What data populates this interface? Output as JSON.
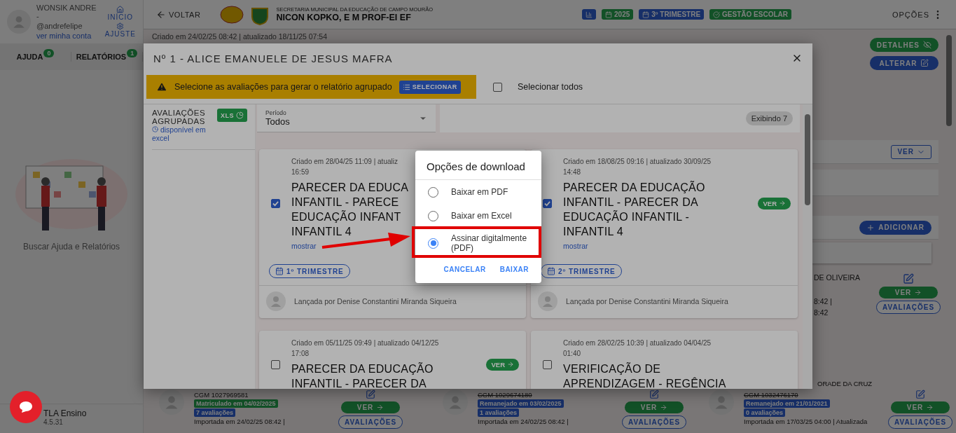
{
  "sidebar": {
    "user_name": "WONSIK ANDRE -",
    "username": "@andrefelipe",
    "account_link": "ver minha conta",
    "nav": [
      {
        "label": "INÍCIO",
        "kind": "home"
      },
      {
        "label": "AJUSTE",
        "kind": "settings"
      }
    ],
    "tabs": [
      {
        "label": "AJUDA",
        "count": "0"
      },
      {
        "label": "RELATÓRIOS",
        "count": "1"
      }
    ],
    "help_caption": "Buscar Ajuda e Relatórios",
    "app_name": "TLA Ensino",
    "version": "4.5.31"
  },
  "header": {
    "back": "VOLTAR",
    "department": "SECRETARIA MUNICIPAL DA EDUCAÇÃO DE CAMPO MOURÃO",
    "school": "NICON KOPKO, E M PROF-EI EF",
    "chips": [
      {
        "kind": "chart"
      },
      {
        "kind": "year",
        "label": "2025"
      },
      {
        "kind": "term",
        "label": "3º TRIMESTRE"
      },
      {
        "kind": "module",
        "label": "GESTÃO ESCOLAR"
      }
    ],
    "options": "OPÇÕES"
  },
  "record_info": "Criado em 24/02/25 08:42 | atualizado 18/11/25 07:54",
  "record_actions": [
    {
      "label": "DETALHES",
      "kind": "details"
    },
    {
      "label": "ALTERAR",
      "kind": "edit"
    }
  ],
  "sections": [
    {
      "kind": "toggle",
      "label": "VER"
    },
    {
      "kind": "empty"
    },
    {
      "kind": "add",
      "label": "ADICIONAR"
    }
  ],
  "previous_row": {
    "name": "DE OLIVEIRA",
    "lines": [
      "8:42 |",
      "8:42"
    ],
    "view": "VER",
    "evaluations": "AVALIAÇÕES"
  },
  "next_row_name": "ORADE DA CRUZ",
  "students": [
    {
      "cgm": "CGM 1027969581",
      "struck": false,
      "status": "Matriculado em 04/02/2025",
      "kind": "enrolled",
      "count": "7 avaliações",
      "imported": "Importada em 24/02/25 08:42 |",
      "view": "VER",
      "evaluations": "AVALIAÇÕES"
    },
    {
      "cgm": "CGM 1029674180",
      "struck": true,
      "status": "Remanejado em 03/02/2025",
      "kind": "moved",
      "count": "1 avaliações",
      "imported": "Importada em 24/02/25 08:42 |",
      "view": "VER",
      "evaluations": "AVALIAÇÕES"
    },
    {
      "cgm": "CGM 1032476170",
      "struck": true,
      "status": "Remanejado em 21/01/2021",
      "kind": "moved",
      "count": "0 avaliações",
      "imported": "Importada em 17/03/25 04:00 | Atualizada",
      "view": "VER",
      "evaluations": "AVALIAÇÕES"
    }
  ],
  "modal": {
    "title": "Nº 1 - ALICE EMANUELE DE JESUS MAFRA",
    "alert": {
      "text": "Selecione as avaliações para gerar o relatório agrupado",
      "button": "SELECIONAR"
    },
    "select_all": {
      "label": "Selecionar todos",
      "checked": false
    },
    "groups": {
      "title": "AVALIAÇÕES AGRUPADAS",
      "link": "disponível em excel",
      "button": "XLS"
    },
    "filter": {
      "label": "Período",
      "value": "Todos"
    },
    "count": "Exibindo 7",
    "evaluations": [
      {
        "checked": true,
        "date_lines": [
          "Criado em 28/04/25 11:09 | atualiz",
          "16:59"
        ],
        "title_lines": [
          "PARECER DA EDUCA",
          "INFANTIL - PARECE",
          "EDUCAÇÃO INFANT",
          "INFANTIL 4"
        ],
        "more": "mostrar",
        "term": "1º TRIMESTRE",
        "author": "Lançada por Denise Constantini Miranda Siqueira"
      },
      {
        "checked": true,
        "date_lines": [
          "Criado em 18/08/25 09:16 | atualizado 30/09/25",
          "14:48"
        ],
        "title_lines": [
          "PARECER DA EDUCAÇÃO",
          "INFANTIL - PARECER DA",
          "EDUCAÇÃO INFANTIL -",
          "INFANTIL 4"
        ],
        "more": "mostrar",
        "action": "VER",
        "term": "2º TRIMESTRE",
        "author": "Lançada por Denise Constantini Miranda Siqueira"
      },
      {
        "checked": false,
        "date_lines": [
          "Criado em 05/11/25 09:49 | atualizado 04/12/25",
          "17:08"
        ],
        "title_lines": [
          "PARECER DA EDUCAÇÃO",
          "INFANTIL - PARECER DA"
        ],
        "action": "VER"
      },
      {
        "checked": false,
        "date_lines": [
          "Criado em 28/02/25 10:39 | atualizado 04/04/25",
          "01:40"
        ],
        "title_lines": [
          "VERIFICAÇÃO DE",
          "APRENDIZAGEM - REGÊNCIA"
        ]
      }
    ]
  },
  "dialog": {
    "title": "Opções de download",
    "options": [
      {
        "label": "Baixar em PDF",
        "selected": false
      },
      {
        "label": "Baixar em Excel",
        "selected": false
      },
      {
        "label": "Assinar digitalmente (PDF)",
        "selected": true
      }
    ],
    "buttons": [
      "CANCELAR",
      "BAIXAR"
    ]
  }
}
